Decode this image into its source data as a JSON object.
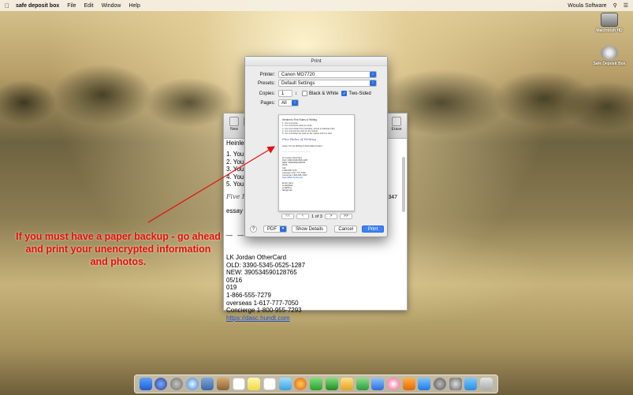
{
  "menubar": {
    "app_name": "safe deposit box",
    "items": [
      "File",
      "Edit",
      "Window",
      "Help"
    ],
    "right_label": "Woula Software"
  },
  "desktop": {
    "disk1": "Macintosh HD",
    "disk2": "Safe Deposit Box"
  },
  "doc_window": {
    "toolbar": {
      "new_label": "New",
      "erase_label": "Erase"
    },
    "heading": "Heinlein",
    "list": [
      "1. You n",
      "2. You n",
      "3. You n",
      "4. You n",
      "5. You n"
    ],
    "fancy_text": "Five R",
    "number_fragment": "347",
    "essay_text": "essay \"",
    "dashes": "— —",
    "card_lines": [
      "LK Jordan  OtherCard",
      "OLD: 3390-5345-0525-1287",
      "NEW: 390534590128765",
      "05/16",
      "019",
      "1-866-555-7279",
      "overseas 1-617-777-7050",
      "Concierge 1-800-955-7293"
    ],
    "card_link": "https://dasc.hundt.com"
  },
  "print_dialog": {
    "title": "Print",
    "printer_label": "Printer:",
    "printer_value": "Canon MG7720",
    "presets_label": "Presets:",
    "presets_value": "Default Settings",
    "copies_label": "Copies:",
    "copies_value": "1",
    "bw_label": "Black & White",
    "two_sided_label": "Two-Sided",
    "pages_label": "Pages:",
    "pages_value": "All",
    "preview_title": "Heinlein's Five Rules of Writing",
    "preview_lines": [
      "1. You must write.",
      "2. You must finish what you write.",
      "3. You must refrain from rewriting, except to editorial order.",
      "4. You must put the work on the market.",
      "5. You must keep the work on the market until it is sold."
    ],
    "preview_fancy": "Five Rules of Writing",
    "preview_essay": "essay \"On the Writing of Speculative Fiction\"",
    "preview_red": "— — — — — — — — — — —",
    "preview_card": [
      "LK Jordan  OtherCard",
      "OLD: 3390-5345-0525-1287",
      "NEW: 390534590128765",
      "05/16",
      "019",
      "1-866-555-7279",
      "overseas 1-617-777-7050",
      "Concierge 1-800-955-7293",
      "https://dasc.hundt.com"
    ],
    "preview_extra": [
      "Email: Harry",
      "email@fake",
      "emailharry",
      "fake@mail"
    ],
    "page_indicator": "1 of 3",
    "pager_first": "<<",
    "pager_prev": "<",
    "pager_next": ">",
    "pager_last": ">>",
    "help_label": "?",
    "pdf_label": "PDF",
    "show_details_label": "Show Details",
    "cancel_label": "Cancel",
    "print_label": "Print"
  },
  "annotation": {
    "text": "If you must have a paper backup - go ahead and print your unencrypted information and photos.",
    "color": "#e80d0d"
  }
}
